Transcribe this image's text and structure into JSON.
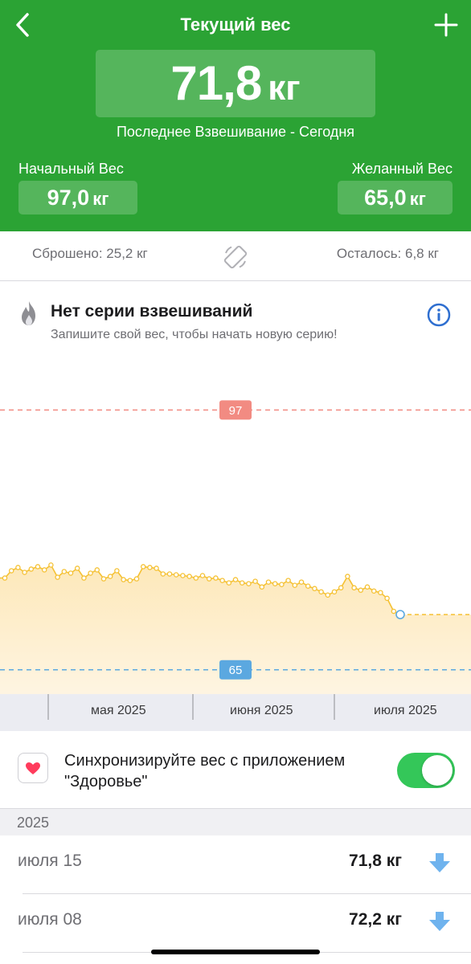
{
  "header": {
    "title": "Текущий вес",
    "current_value": "71,8",
    "current_unit": "кг",
    "last_weighin": "Последнее Взвешивание - Сегодня",
    "start_label": "Начальный Вес",
    "start_value": "97,0",
    "start_unit": "кг",
    "goal_label": "Желанный Вес",
    "goal_value": "65,0",
    "goal_unit": "кг"
  },
  "stats": {
    "lost": "Сброшено: 25,2 кг",
    "remaining": "Осталось: 6,8 кг"
  },
  "streak": {
    "title": "Нет серии взвешиваний",
    "subtitle": "Запишите свой вес, чтобы начать новую серию!"
  },
  "chart_data": {
    "type": "line",
    "x_ticks": [
      "мая 2025",
      "июня 2025",
      "июля 2025"
    ],
    "start_line": "97",
    "goal_line": "65",
    "ylim": [
      62,
      101
    ],
    "values": [
      76.3,
      77.2,
      77.6,
      77.0,
      77.4,
      77.7,
      77.3,
      77.9,
      76.4,
      77.1,
      76.9,
      77.5,
      76.3,
      76.9,
      77.3,
      76.2,
      76.5,
      77.2,
      76.1,
      76.0,
      76.2,
      77.7,
      77.6,
      77.5,
      76.8,
      76.8,
      76.7,
      76.6,
      76.5,
      76.3,
      76.6,
      76.2,
      76.3,
      76.0,
      75.7,
      76.1,
      75.7,
      75.6,
      75.9,
      75.2,
      75.8,
      75.6,
      75.5,
      76.0,
      75.4,
      75.8,
      75.3,
      75.0,
      74.6,
      74.2,
      74.6,
      75.1,
      76.5,
      75.1,
      74.8,
      75.2,
      74.7,
      74.5,
      73.8,
      72.2,
      71.8
    ],
    "grid": false,
    "colors": {
      "line": "#f5c133",
      "start_line": "#f28b82",
      "goal_line": "#5ba8e0",
      "fill": "#fde7b6"
    }
  },
  "sync": {
    "text": "Синхронизируйте вес с приложением \"Здоровье\"",
    "enabled": true
  },
  "history": {
    "year": "2025",
    "entries": [
      {
        "date": "июля 15",
        "weight": "71,8 кг",
        "trend": "down"
      },
      {
        "date": "июля 08",
        "weight": "72,2 кг",
        "trend": "down"
      }
    ]
  },
  "icons": {
    "back": "chevron-left-icon",
    "add": "plus-icon",
    "rotate": "rotate-screen-icon",
    "streak": "flame-icon",
    "info": "info-icon",
    "health": "heart-icon",
    "trend_down": "arrow-down-icon"
  }
}
